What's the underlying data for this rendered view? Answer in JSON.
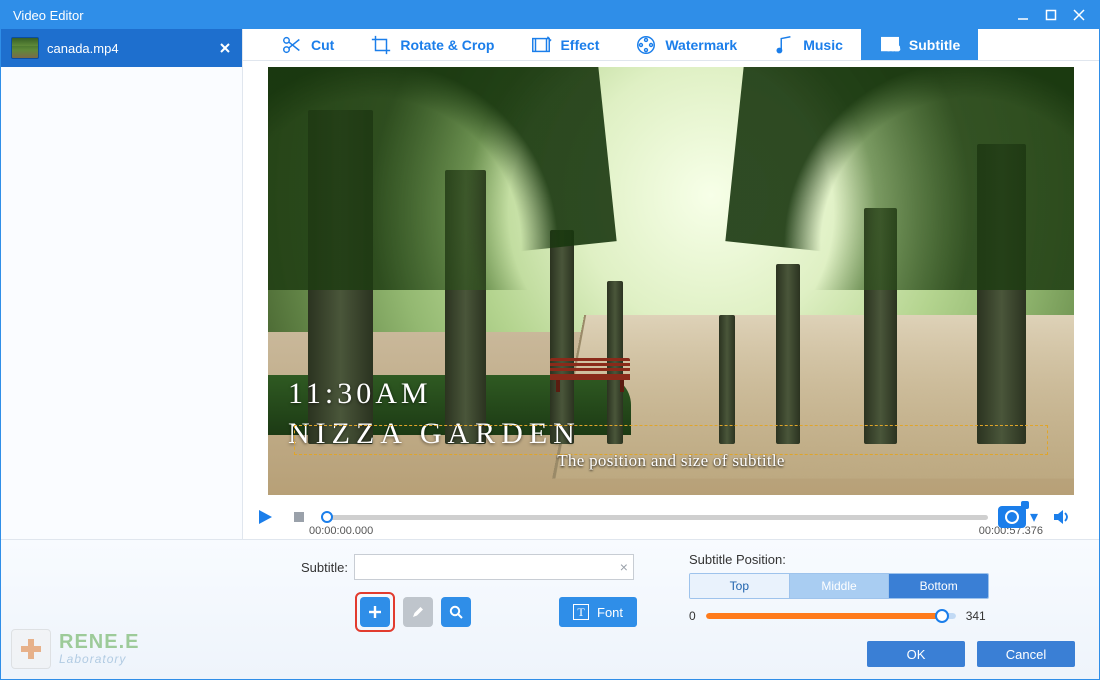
{
  "titlebar": {
    "title": "Video Editor"
  },
  "file": {
    "name": "canada.mp4"
  },
  "toolbar": {
    "items": [
      {
        "label": "Cut"
      },
      {
        "label": "Rotate & Crop"
      },
      {
        "label": "Effect"
      },
      {
        "label": "Watermark"
      },
      {
        "label": "Music"
      },
      {
        "label": "Subtitle"
      }
    ],
    "active_index": 5
  },
  "preview": {
    "overlay_time": "11:30AM",
    "overlay_place": "NIZZA GARDEN",
    "subtitle_sample": "The position and size of subtitle"
  },
  "playback": {
    "time_current": "00:00:00.000",
    "time_total": "00:00:57.376"
  },
  "subtitle_panel": {
    "label": "Subtitle:",
    "value": "",
    "placeholder": "",
    "font_button": "Font"
  },
  "position_panel": {
    "label": "Subtitle Position:",
    "segments": [
      "Top",
      "Middle",
      "Bottom"
    ],
    "active_segment": 2,
    "slider_min": "0",
    "slider_value": 341,
    "slider_value_text": "341",
    "slider_max": 360,
    "fill_pct": 94.7
  },
  "footer": {
    "ok": "OK",
    "cancel": "Cancel"
  },
  "watermark": {
    "line1": "RENE.E",
    "line2": "Laboratory"
  }
}
